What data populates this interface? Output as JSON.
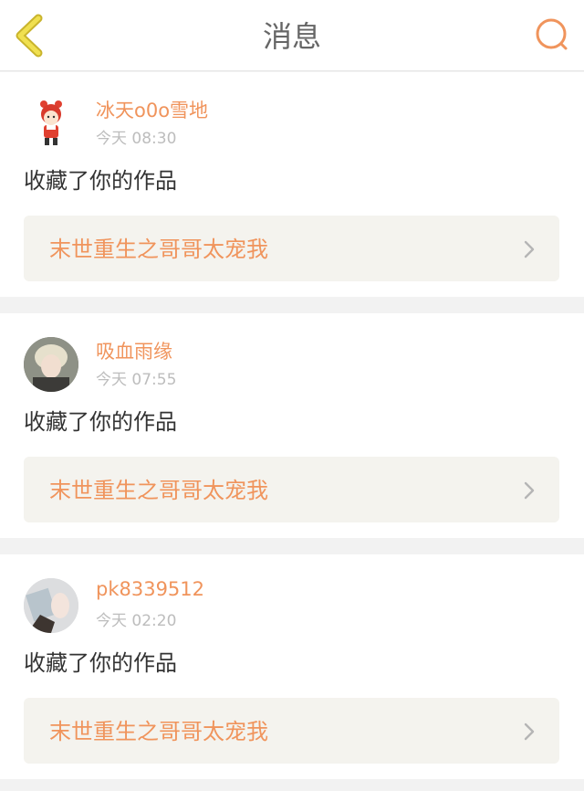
{
  "header": {
    "title": "消息",
    "back_icon": "chevron-left-icon",
    "search_icon": "search-icon",
    "back_color": "#e8d848",
    "search_color": "#f0945c"
  },
  "messages": [
    {
      "username": "冰天o0o雪地",
      "time": "今天 08:30",
      "action": "收藏了你的作品",
      "work_title": "末世重生之哥哥太宠我",
      "avatar": "cartoon-avatar"
    },
    {
      "username": "吸血雨缘",
      "time": "今天 07:55",
      "action": "收藏了你的作品",
      "work_title": "末世重生之哥哥太宠我",
      "avatar": "photo-avatar"
    },
    {
      "username": "pk8339512",
      "time": "今天 02:20",
      "action": "收藏了你的作品",
      "work_title": "末世重生之哥哥太宠我",
      "avatar": "photo-avatar"
    }
  ],
  "colors": {
    "accent": "#f0945c",
    "card_link_bg": "#f4f3ee",
    "page_bg": "#f2f2f2"
  }
}
